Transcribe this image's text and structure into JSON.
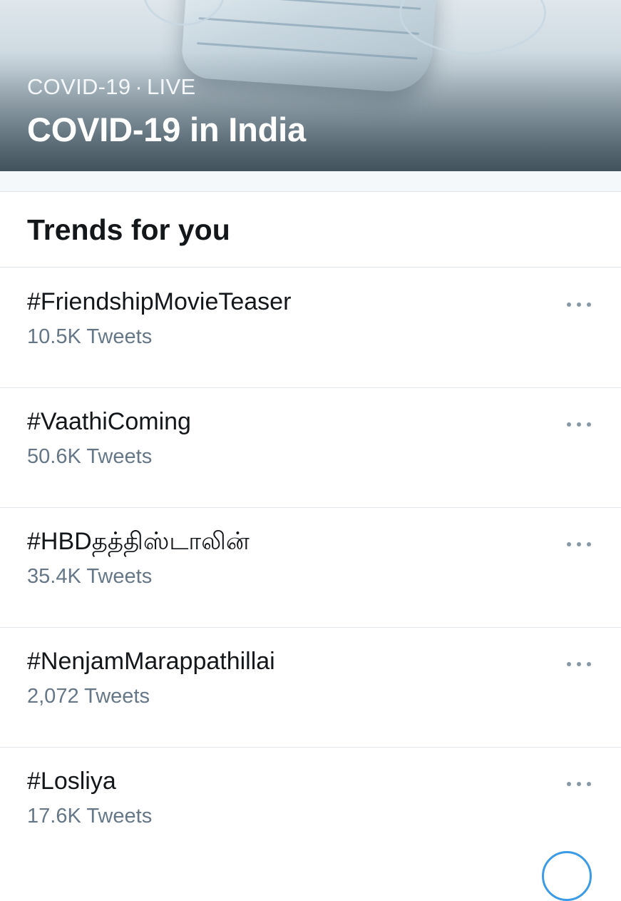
{
  "hero": {
    "category": "COVID-19",
    "separator": "·",
    "status": "LIVE",
    "title": "COVID-19 in India"
  },
  "section": {
    "title": "Trends for you"
  },
  "trends": [
    {
      "name": "#FriendshipMovieTeaser",
      "count": "10.5K Tweets"
    },
    {
      "name": "#VaathiComing",
      "count": "50.6K Tweets"
    },
    {
      "name": "#HBDதத்திஸ்டாலின்",
      "count": "35.4K Tweets"
    },
    {
      "name": "#NenjamMarappathillai",
      "count": "2,072 Tweets"
    },
    {
      "name": "#Losliya",
      "count": "17.6K Tweets"
    }
  ],
  "icons": {
    "more": "more-horizontal-icon"
  },
  "colors": {
    "primary_text": "#14171a",
    "secondary_text": "#657786",
    "divider": "#e1e6ea",
    "accent": "#1da1f2"
  }
}
